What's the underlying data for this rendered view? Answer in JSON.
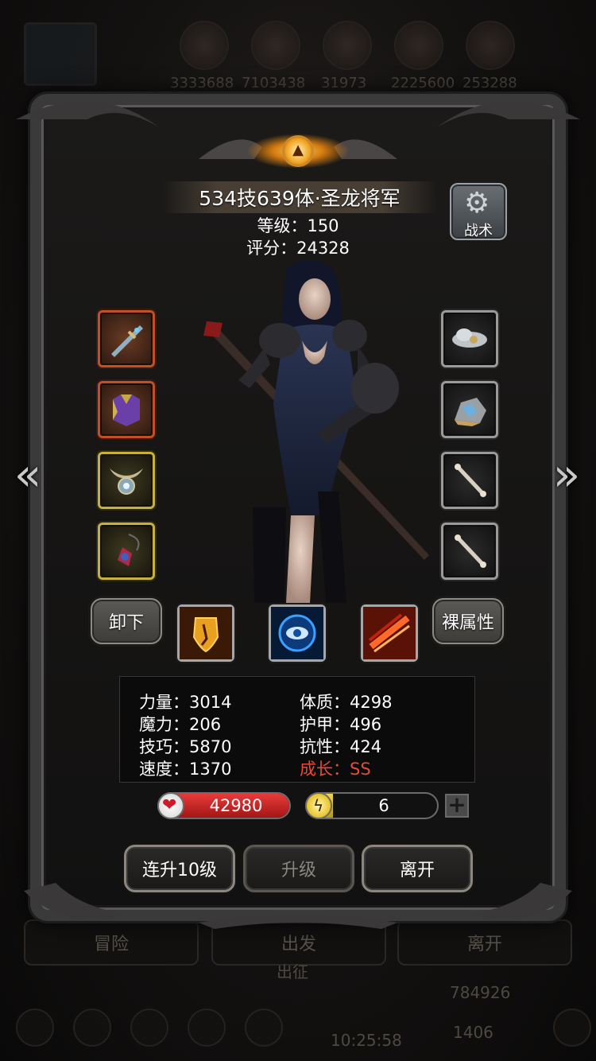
{
  "background": {
    "resources": [
      "3333688",
      "7103438",
      "31973",
      "2225600",
      "253288"
    ],
    "buttons": [
      "冒险",
      "出发",
      "离开"
    ],
    "gold": "784926",
    "gems": "1406",
    "clock": "10:25:58",
    "mission": "出征"
  },
  "hero": {
    "name": "534技639体·圣龙将军",
    "level": "等级：150",
    "score": "评分：24328"
  },
  "tactics_label": "战术",
  "actions": {
    "unequip": "卸下",
    "bare_stats": "裸属性"
  },
  "skills": [
    "shield-skill-icon",
    "eye-skill-icon",
    "slash-skill-icon"
  ],
  "equipment": {
    "left": [
      "sword-icon",
      "armor-icon",
      "amulet-icon",
      "necklace-icon"
    ],
    "right": [
      "cloud-relic-icon",
      "ore-icon",
      "bone-icon",
      "bone-icon"
    ],
    "left_rarity": [
      "orange",
      "orange",
      "gold",
      "gold"
    ],
    "right_rarity": [
      "gray",
      "gray",
      "gray",
      "gray"
    ]
  },
  "stats": {
    "strength": "力量：3014",
    "magic": "魔力：206",
    "skill": "技巧：5870",
    "speed": "速度：1370",
    "physique": "体质：4298",
    "armor": "护甲：496",
    "resist": "抗性：424",
    "growth": "成长：SS"
  },
  "hp": {
    "value": "42980",
    "fill": 1.0
  },
  "energy": {
    "value": "6",
    "fill": 0.2
  },
  "plus_label": "+",
  "buttons": {
    "level_up_10": "连升10级",
    "level_up": "升级",
    "leave": "离开"
  },
  "colors": {
    "growth": "#e24b3a",
    "hp": "#d42424",
    "energy": "#e3c32e",
    "orange_slot": "#c0502a",
    "gold_slot": "#c8b040",
    "gray_slot": "#9a9a9a"
  }
}
